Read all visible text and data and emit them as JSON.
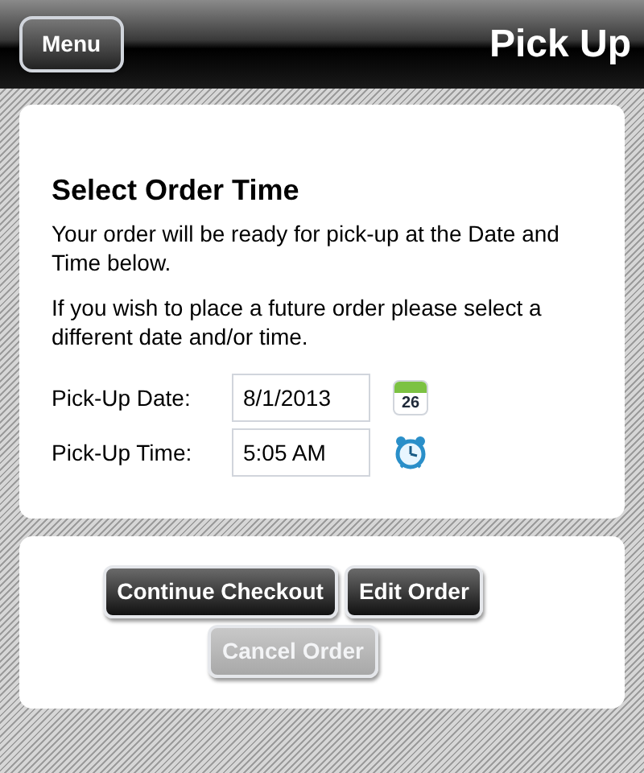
{
  "header": {
    "menu_button": "Menu",
    "title": "Pick Up"
  },
  "order_time": {
    "heading": "Select Order Time",
    "paragraphs": [
      "Your order will be ready for pick-up at the Date and Time below.",
      "If you wish to place a future order please select a different date and/or time."
    ],
    "fields": [
      {
        "label": "Pick-Up Date:",
        "value": "8/1/2013",
        "kind": "date",
        "icon_text": "26"
      },
      {
        "label": "Pick-Up Time:",
        "value": "5:05 AM",
        "kind": "time"
      }
    ]
  },
  "actions": [
    [
      {
        "label": "Continue Checkout",
        "disabled": false
      },
      {
        "label": "Edit Order",
        "disabled": false
      }
    ],
    [
      {
        "label": "Cancel Order",
        "disabled": true
      }
    ]
  ]
}
